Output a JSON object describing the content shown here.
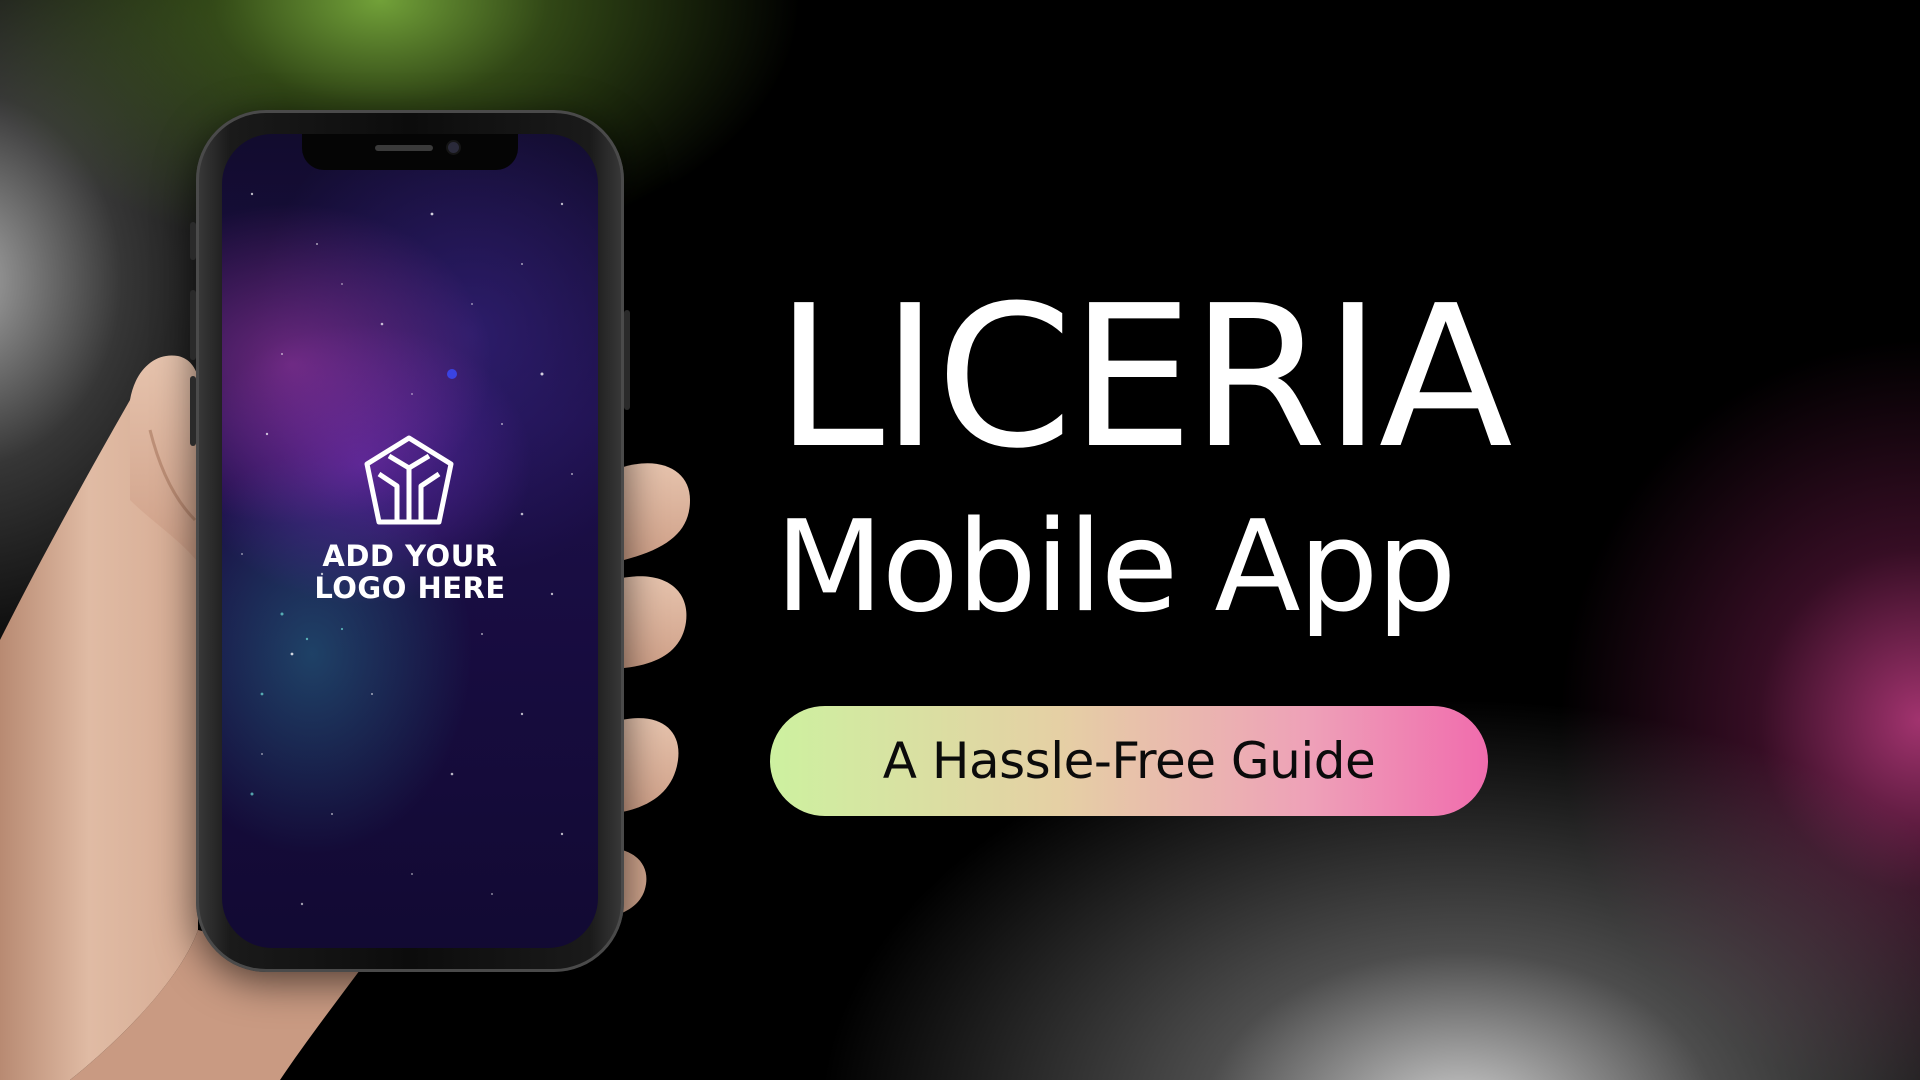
{
  "screen": {
    "logo_line1": "ADD YOUR",
    "logo_line2": "LOGO HERE",
    "logo_icon": "hexagon-logo-icon"
  },
  "headline": {
    "title": "LICERIA",
    "subtitle": "Mobile App"
  },
  "tagline": {
    "text": "A Hassle-Free Guide"
  },
  "colors": {
    "background": "#000000",
    "glow_green": "#78aa3c",
    "glow_pink": "#be3c82",
    "pill_start": "#cdf1a0",
    "pill_end": "#f06cad",
    "text_light": "#ffffff",
    "text_dark": "#0b0b0b"
  }
}
